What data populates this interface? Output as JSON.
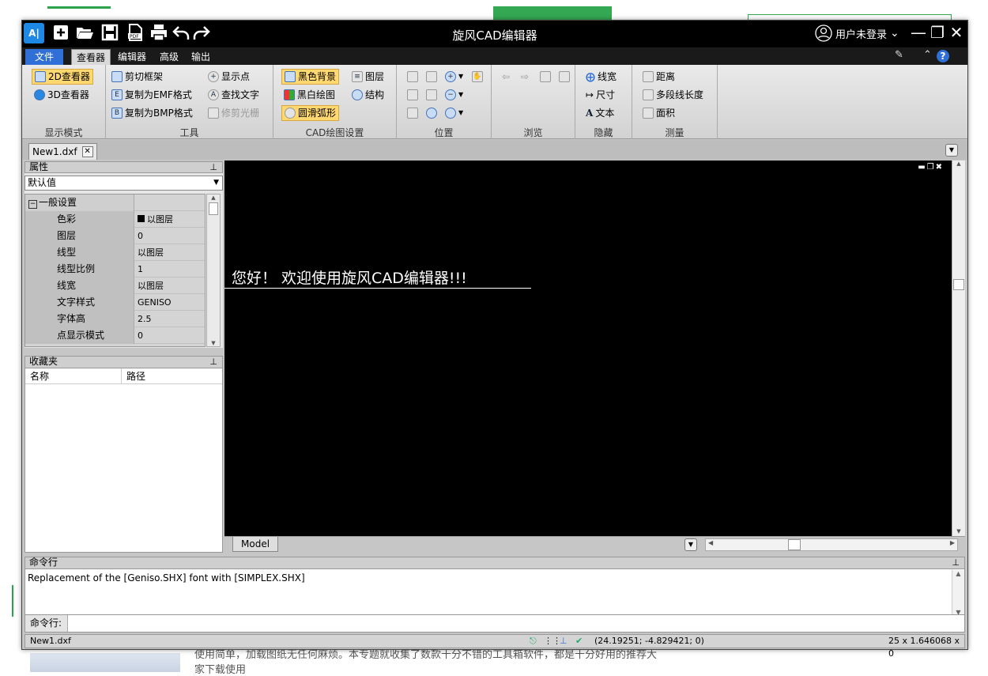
{
  "background_page": {
    "text_line1": "使用简单，加载图纸无任何麻烦。本专题就收集了数款十分不错的工具箱软件，都是十分好用的推荐大",
    "text_line2": "家下载使用"
  },
  "window": {
    "title": "旋风CAD编辑器",
    "logo_text": "A|",
    "login_label": "用户未登录",
    "accent_color": "#2f6fd6"
  },
  "quick_access": [
    "new-icon",
    "open-folder-icon",
    "save-icon",
    "pdf-icon",
    "print-icon",
    "undo-icon",
    "redo-icon"
  ],
  "ribbon_tabs": {
    "file": "文件",
    "viewer": "查看器",
    "editor": "编辑器",
    "advanced": "高级",
    "output": "输出"
  },
  "ribbon": {
    "display_mode": {
      "label": "显示模式",
      "viewer_2d": "2D查看器",
      "viewer_3d": "3D查看器"
    },
    "tools": {
      "label": "工具",
      "clip_frame": "剪切框架",
      "copy_emf": "复制为EMF格式",
      "copy_bmp": "复制为BMP格式",
      "show_points": "显示点",
      "find_text": "查找文字",
      "trim_raster": "修剪光栅"
    },
    "cad_settings": {
      "label": "CAD绘图设置",
      "black_bg": "黑色背景",
      "layers": "图层",
      "bw_draw": "黑白绘图",
      "structure": "结构",
      "smooth_arc": "圆滑弧形"
    },
    "position": {
      "label": "位置"
    },
    "browse": {
      "label": "浏览"
    },
    "hide": {
      "label": "隐藏",
      "lineweight": "线宽",
      "dimension": "尺寸",
      "text": "文本"
    },
    "measure": {
      "label": "测量",
      "distance": "距离",
      "polyline_length": "多段线长度",
      "area": "面积"
    }
  },
  "document_tab": "New1.dxf",
  "properties": {
    "title": "属性",
    "selector": "默认值",
    "category": "一般设置",
    "rows": [
      {
        "name": "色彩",
        "value": "以图层"
      },
      {
        "name": "图层",
        "value": "0"
      },
      {
        "name": "线型",
        "value": "以图层"
      },
      {
        "name": "线型比例",
        "value": "1"
      },
      {
        "name": "线宽",
        "value": "以图层"
      },
      {
        "name": "文字样式",
        "value": "GENISO"
      },
      {
        "name": "字体高",
        "value": "2.5"
      },
      {
        "name": "点显示模式",
        "value": "0"
      }
    ]
  },
  "favorites": {
    "title": "收藏夹",
    "col_name": "名称",
    "col_path": "路径"
  },
  "canvas": {
    "welcome_text": "您好！ 欢迎使用旋风CAD编辑器!!!",
    "model_tab": "Model"
  },
  "command": {
    "title": "命令行",
    "log": "Replacement of the [Geniso.SHX] font with [SIMPLEX.SHX]",
    "prompt_label": "命令行:",
    "input_value": ""
  },
  "status": {
    "file": "New1.dxf",
    "coords": "(24.19251; -4.829421; 0)",
    "size": "25 x 1.646068 x 0"
  }
}
